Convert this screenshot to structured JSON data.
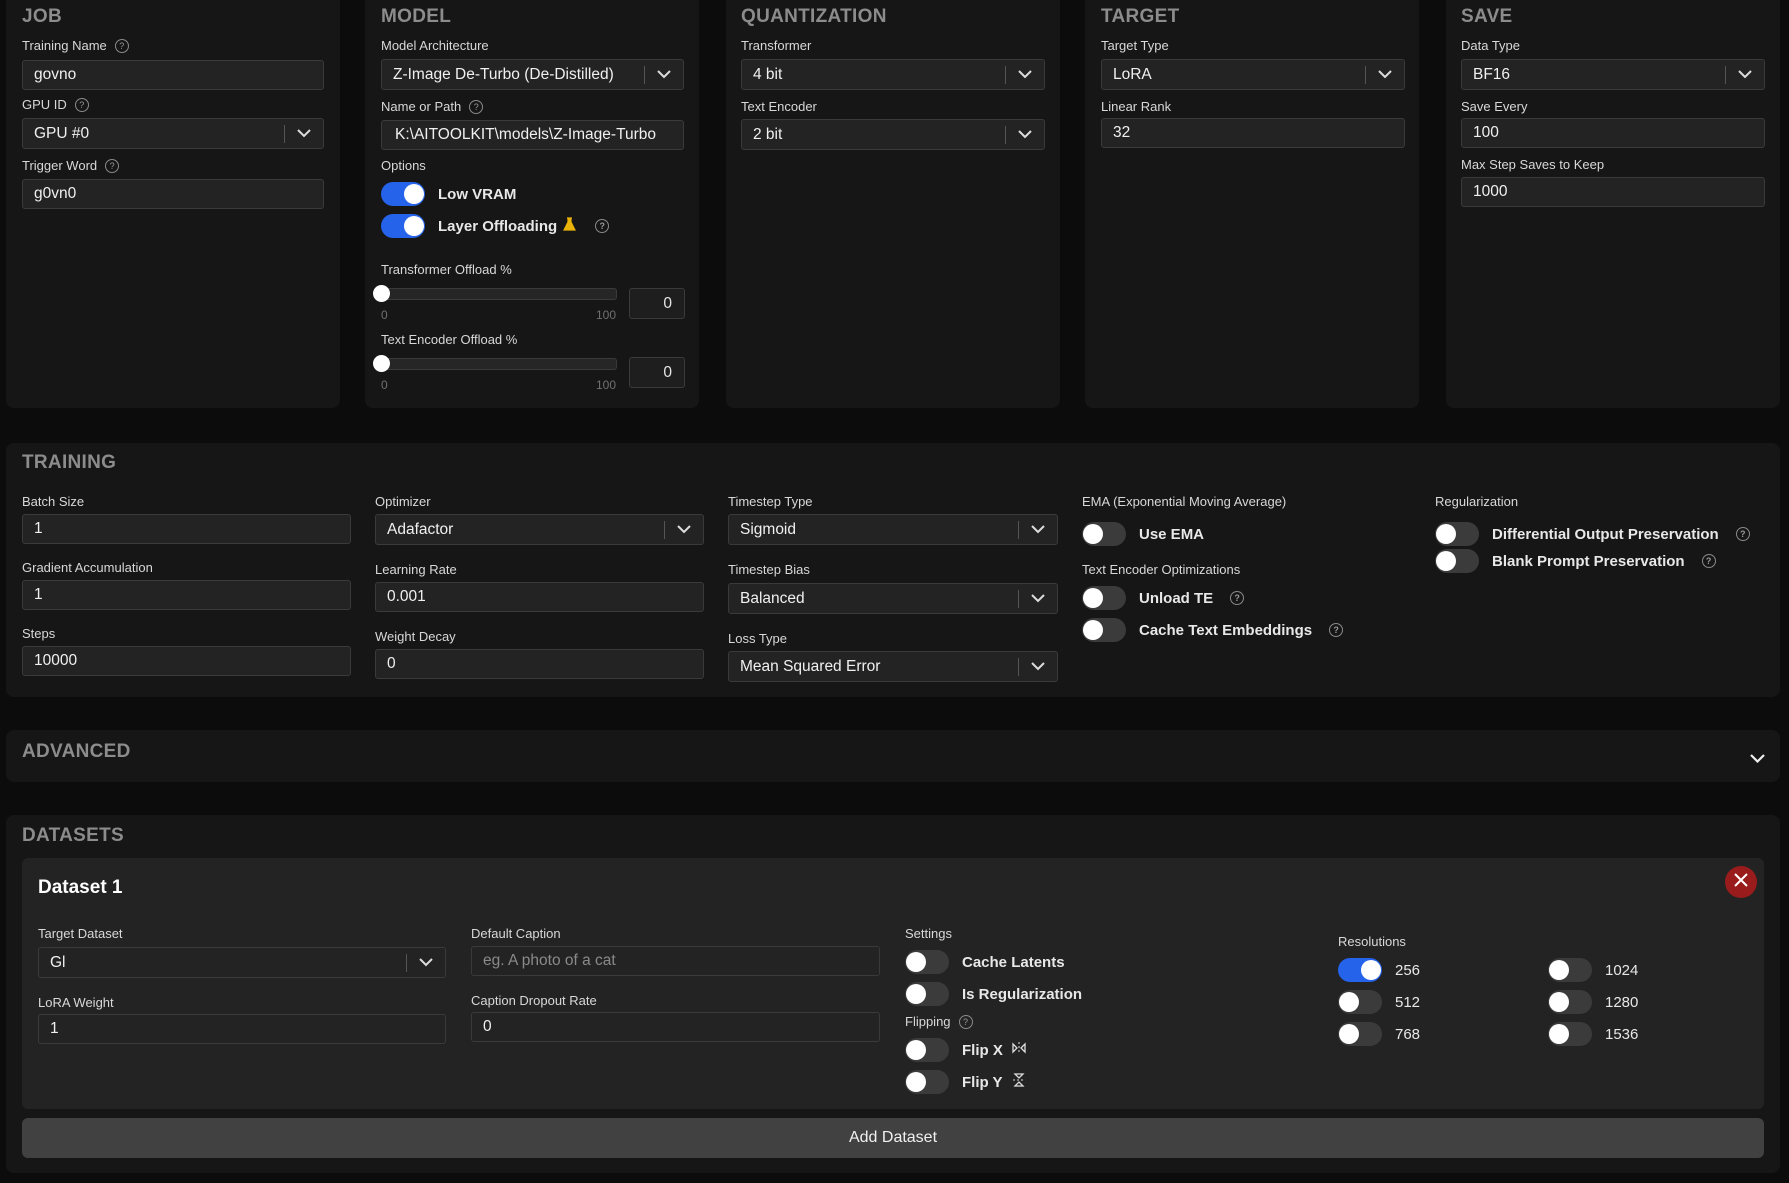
{
  "job": {
    "title": "JOB",
    "training_name_label": "Training Name",
    "training_name": "govno",
    "gpu_label": "GPU ID",
    "gpu": "GPU #0",
    "trigger_label": "Trigger Word",
    "trigger": "g0vn0"
  },
  "model": {
    "title": "MODEL",
    "arch_label": "Model Architecture",
    "arch": "Z-Image De-Turbo (De-Distilled)",
    "path_label": "Name or Path",
    "path": "K:\\AITOOLKIT\\models\\Z-Image-Turbo",
    "options_label": "Options",
    "low_vram": "Low VRAM",
    "low_vram_on": true,
    "layer_offloading": "Layer Offloading",
    "layer_offloading_on": true,
    "transformer_offload_label": "Transformer Offload %",
    "transformer_offload": "0",
    "text_encoder_offload_label": "Text Encoder Offload %",
    "text_encoder_offload": "0",
    "slider_min": "0",
    "slider_max": "100"
  },
  "quantization": {
    "title": "QUANTIZATION",
    "transformer_label": "Transformer",
    "transformer": "4 bit",
    "text_encoder_label": "Text Encoder",
    "text_encoder": "2 bit"
  },
  "target": {
    "title": "TARGET",
    "type_label": "Target Type",
    "type": "LoRA",
    "rank_label": "Linear Rank",
    "rank": "32"
  },
  "save": {
    "title": "SAVE",
    "dtype_label": "Data Type",
    "dtype": "BF16",
    "every_label": "Save Every",
    "every": "100",
    "max_label": "Max Step Saves to Keep",
    "max": "1000"
  },
  "training": {
    "title": "TRAINING",
    "batch_label": "Batch Size",
    "batch": "1",
    "grad_label": "Gradient Accumulation",
    "grad": "1",
    "steps_label": "Steps",
    "steps": "10000",
    "optimizer_label": "Optimizer",
    "optimizer": "Adafactor",
    "lr_label": "Learning Rate",
    "lr": "0.001",
    "wd_label": "Weight Decay",
    "wd": "0",
    "ts_type_label": "Timestep Type",
    "ts_type": "Sigmoid",
    "ts_bias_label": "Timestep Bias",
    "ts_bias": "Balanced",
    "loss_label": "Loss Type",
    "loss": "Mean Squared Error",
    "ema_label": "EMA (Exponential Moving Average)",
    "use_ema": "Use EMA",
    "te_opt_label": "Text Encoder Optimizations",
    "unload_te": "Unload TE",
    "cache_te": "Cache Text Embeddings",
    "reg_label": "Regularization",
    "diff_output": "Differential Output Preservation",
    "blank_prompt": "Blank Prompt Preservation"
  },
  "advanced": {
    "title": "ADVANCED"
  },
  "datasets": {
    "title": "DATASETS",
    "add_label": "Add Dataset",
    "items": [
      {
        "title": "Dataset 1",
        "target_label": "Target Dataset",
        "target": "Gl",
        "lora_weight_label": "LoRA Weight",
        "lora_weight": "1",
        "caption_label": "Default Caption",
        "caption_placeholder": "eg. A photo of a cat",
        "dropout_label": "Caption Dropout Rate",
        "dropout": "0",
        "settings_label": "Settings",
        "cache_latents": "Cache Latents",
        "is_reg": "Is Regularization",
        "flipping_label": "Flipping",
        "flip_x": "Flip X",
        "flip_y": "Flip Y",
        "resolutions_label": "Resolutions",
        "resolutions": [
          {
            "value": "256",
            "on": true
          },
          {
            "value": "512",
            "on": false
          },
          {
            "value": "768",
            "on": false
          },
          {
            "value": "1024",
            "on": false
          },
          {
            "value": "1280",
            "on": false
          },
          {
            "value": "1536",
            "on": false
          }
        ]
      }
    ]
  },
  "colors": {
    "accent": "#2563eb",
    "danger": "#991b1b",
    "warning": "#eab308"
  }
}
